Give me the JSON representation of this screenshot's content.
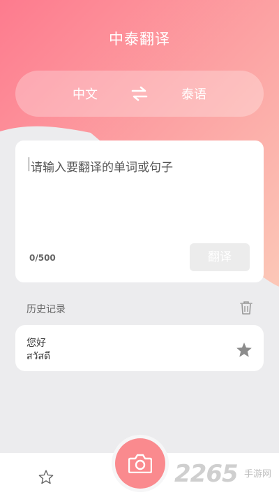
{
  "header": {
    "title": "中泰翻译"
  },
  "language_bar": {
    "source_lang": "中文",
    "target_lang": "泰语"
  },
  "input": {
    "placeholder": "请输入要翻译的单词或句子",
    "counter": "0/500",
    "translate_label": "翻译"
  },
  "history": {
    "title": "历史记录",
    "items": [
      {
        "source": "您好",
        "target": "สวัสดี"
      }
    ]
  },
  "watermark": {
    "number": "2265",
    "text": "手游网"
  },
  "colors": {
    "gradient_start": "#fd7f8c",
    "gradient_end": "#fcc1b8",
    "background": "#ececee",
    "camera": "#fa8a8e"
  }
}
